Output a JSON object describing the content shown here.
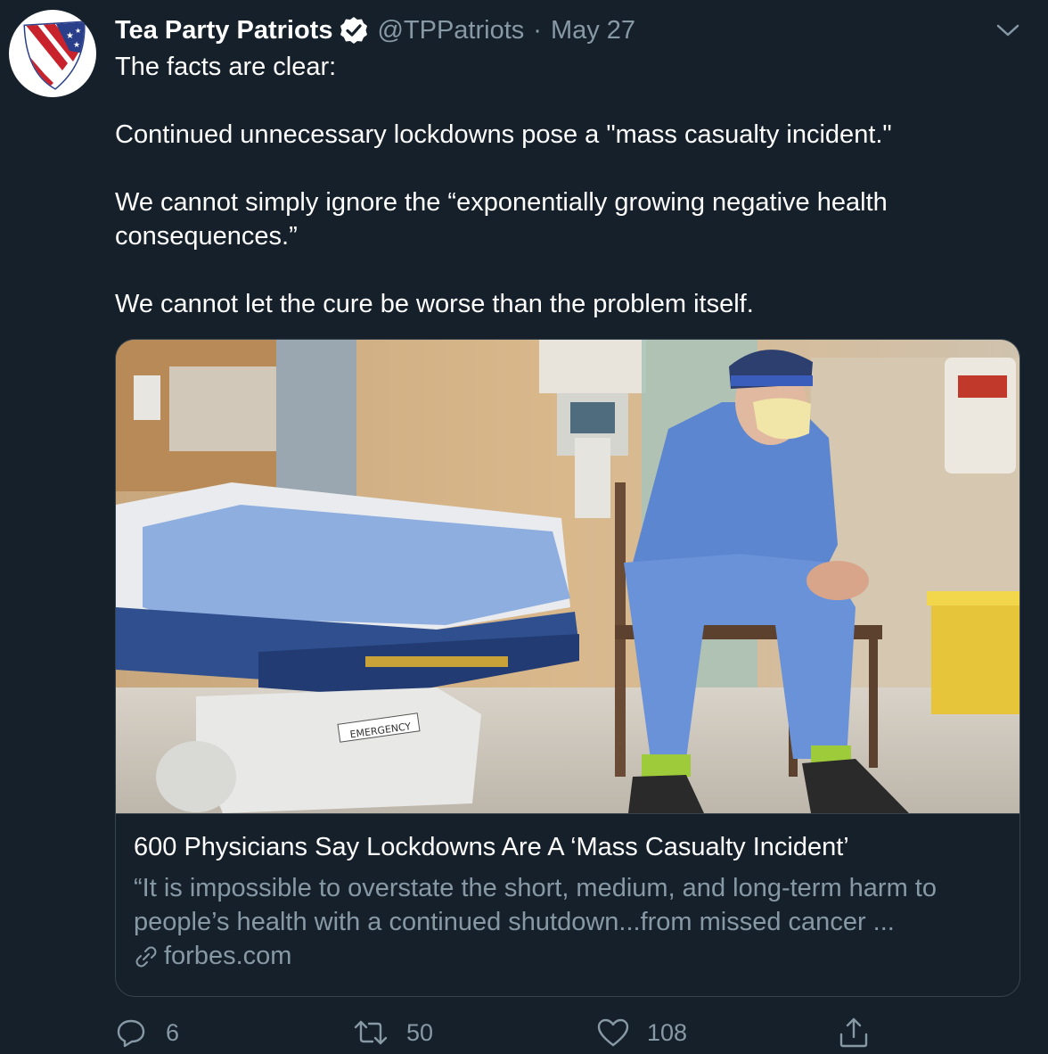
{
  "tweet": {
    "display_name": "Tea Party Patriots",
    "handle": "@TPPatriots",
    "separator": "·",
    "date": "May 27",
    "lines": [
      "The facts are clear:",
      "Continued unnecessary lockdowns pose a \"mass casualty incident.\"",
      "We cannot simply ignore the “exponentially growing negative health consequences.”",
      "We cannot let the cure be worse than the problem itself."
    ]
  },
  "card": {
    "title": "600 Physicians Say Lockdowns Are A ‘Mass Casualty Incident’",
    "description": "“It is impossible to overstate the short, medium, and long-term harm to people’s health with a continued shutdown...from missed cancer ...",
    "domain": "forbes.com",
    "stretcher_label": "EMERGENCY"
  },
  "actions": {
    "replies": "6",
    "retweets": "50",
    "likes": "108"
  },
  "colors": {
    "background": "#15202b",
    "secondary_text": "#8899a6",
    "border": "#38444d"
  },
  "icons": [
    "shield-flag-logo",
    "verified-badge-icon",
    "chevron-down-icon",
    "reply-icon",
    "retweet-icon",
    "like-icon",
    "share-icon",
    "link-icon"
  ]
}
